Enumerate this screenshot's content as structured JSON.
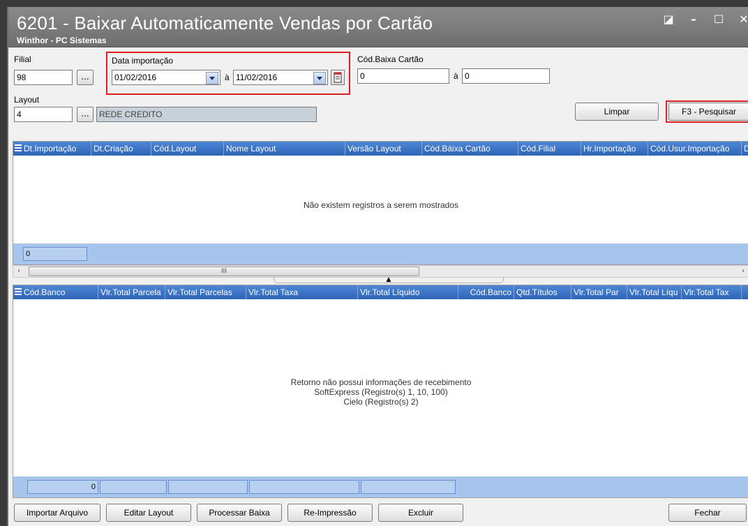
{
  "window": {
    "title": "6201 - Baixar Automaticamente Vendas por Cartão",
    "subtitle": "Winthor - PC Sistemas"
  },
  "form": {
    "filial_label": "Filial",
    "filial_value": "98",
    "dots": "...",
    "data_importacao_label": "Data importação",
    "data_inicio": "01/02/2016",
    "a_label": "à",
    "data_fim": "11/02/2016",
    "cod_baixa_label": "Cód.Baixa Cartão",
    "cod_baixa_de": "0",
    "cod_baixa_ate": "0",
    "layout_label": "Layout",
    "layout_value": "4",
    "layout_nome": "REDE CREDITO",
    "limpar": "Limpar",
    "pesquisar": "F3 - Pesquisar"
  },
  "grid1": {
    "columns": [
      "Dt.Importação",
      "Dt.Criação",
      "Cód.Layout",
      "Nome Layout",
      "Versão Layout",
      "Cód.Báixa Cartão",
      "Cód.Filial",
      "Hr.Importação",
      "Cód.Usur.Importação",
      "D"
    ],
    "empty_message": "Não existem registros a serem mostrados",
    "footer_count": "0"
  },
  "scroll": {
    "left": "‹",
    "thumb": "III",
    "right": "›"
  },
  "grid2": {
    "columns": [
      "Cód.Banco",
      "Vlr.Total Parcela",
      "Vlr.Total Parcelas",
      "Vlr.Total Taxa",
      "Vlr.Total Líquido",
      "Cód.Banco",
      "Qtd.Títulos",
      "Vlr.Total Par",
      "Vlr.Total Líqu",
      "Vlr.Total Tax"
    ],
    "empty_line1": "Retorno não possui informações de recebimento",
    "empty_line2": "SoftExpress (Registro(s) 1, 10, 100)",
    "empty_line3": "Cielo (Registro(s) 2)",
    "footer_count": "0"
  },
  "buttons": {
    "importar": "Importar Arquivo",
    "editar": "Editar Layout",
    "processar": "Processar Baixa",
    "reimpressao": "Re-Impressão",
    "excluir": "Excluir",
    "fechar": "Fechar"
  },
  "colors": {
    "grid_header": "#3b72c6",
    "highlight": "#e02020",
    "footer": "#a7c4ec"
  },
  "icons": [
    "restore-icon",
    "minimize-icon",
    "maximize-icon",
    "close-icon",
    "dropdown-icon",
    "calendar-icon",
    "grid-menu-icon"
  ]
}
